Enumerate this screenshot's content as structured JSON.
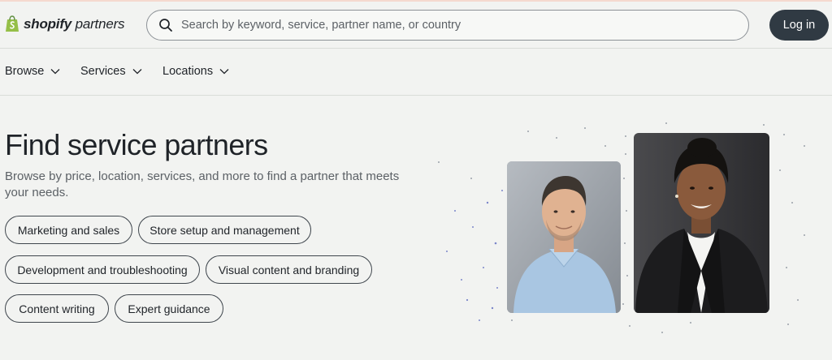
{
  "header": {
    "logo": {
      "brand": "shopify",
      "suffix": "partners",
      "icon": "shopify-bag-icon"
    },
    "search": {
      "placeholder": "Search by keyword, service, partner name, or country",
      "icon": "search-icon"
    },
    "login_label": "Log in"
  },
  "nav": {
    "items": [
      {
        "label": "Browse",
        "icon": "chevron-down-icon"
      },
      {
        "label": "Services",
        "icon": "chevron-down-icon"
      },
      {
        "label": "Locations",
        "icon": "chevron-down-icon"
      }
    ]
  },
  "hero": {
    "title": "Find service partners",
    "subtitle": "Browse by price, location, services, and more to find a partner that meets your needs.",
    "categories": [
      "Marketing and sales",
      "Store setup and management",
      "Development and troubleshooting",
      "Visual content and branding",
      "Content writing",
      "Expert guidance"
    ]
  },
  "colors": {
    "background": "#f2f3f1",
    "login_button": "#303a43",
    "logo_green": "#95bf47",
    "text": "#1f2328"
  }
}
